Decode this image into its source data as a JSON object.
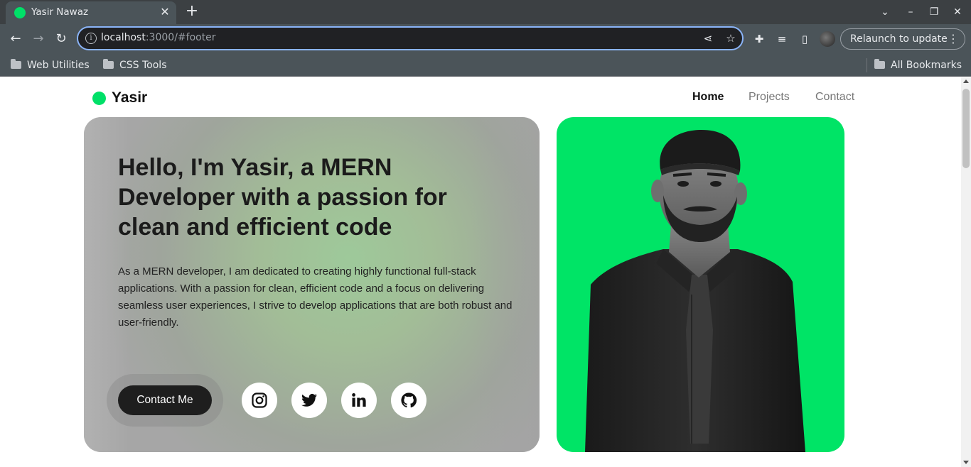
{
  "browser": {
    "tab_title": "Yasir Nawaz",
    "url_host": "localhost",
    "url_rest": ":3000/#footer",
    "relaunch_label": "Relaunch to update",
    "bookmarks": [
      "Web Utilities",
      "CSS Tools"
    ],
    "all_bookmarks": "All Bookmarks"
  },
  "site": {
    "brand": "Yasir",
    "brand_color": "#00e068",
    "nav": [
      {
        "label": "Home",
        "active": true
      },
      {
        "label": "Projects",
        "active": false
      },
      {
        "label": "Contact",
        "active": false
      }
    ]
  },
  "hero": {
    "title": "Hello, I'm Yasir, a MERN Developer with a passion for clean and efficient code",
    "description": "As a MERN developer, I am dedicated to creating highly functional full-stack applications. With a passion for clean, efficient code and a focus on delivering seamless user experiences, I strive to develop applications that are both robust and user-friendly.",
    "cta_label": "Contact Me",
    "socials": [
      {
        "icon": "instagram-icon"
      },
      {
        "icon": "twitter-icon"
      },
      {
        "icon": "linkedin-icon"
      },
      {
        "icon": "github-icon"
      }
    ]
  },
  "photo": {
    "background": "#00e466"
  }
}
